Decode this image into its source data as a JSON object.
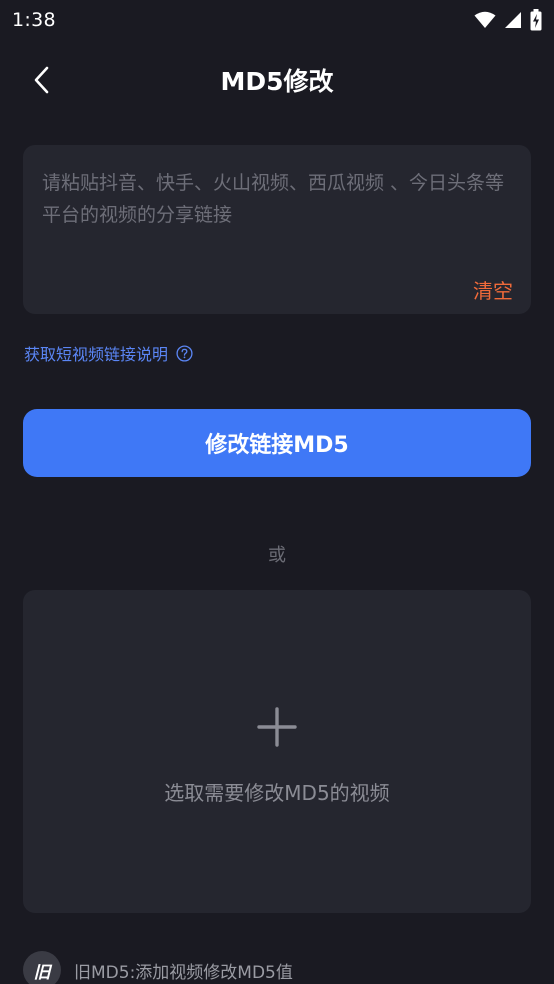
{
  "status_bar": {
    "time": "1:38",
    "icons": [
      "wifi-icon",
      "cellular-signal-icon",
      "battery-charging-icon"
    ]
  },
  "header": {
    "title": "MD5修改",
    "back_icon": "chevron-left-icon"
  },
  "link_input": {
    "placeholder": "请粘贴抖音、快手、火山视频、西瓜视频 、今日头条等平台的视频的分享链接",
    "value": "",
    "clear_label": "清空"
  },
  "help_link": {
    "label": "获取短视频链接说明",
    "icon": "question-circle-icon"
  },
  "primary_button": {
    "label": "修改链接MD5"
  },
  "or_label": "或",
  "video_picker": {
    "icon": "plus-icon",
    "label": "选取需要修改MD5的视频"
  },
  "footer_note": {
    "badge": "旧",
    "text": "旧MD5:添加视频修改MD5值"
  },
  "colors": {
    "background": "#1a1a22",
    "card": "#25262f",
    "accent": "#3f78f6",
    "link": "#5b86f5",
    "clear": "#f06a3a"
  }
}
